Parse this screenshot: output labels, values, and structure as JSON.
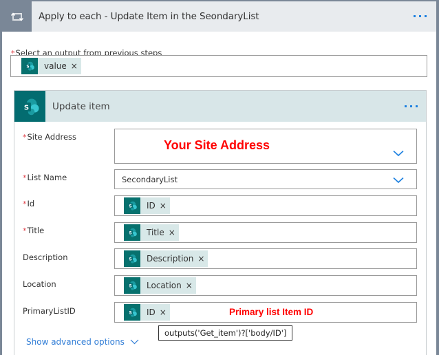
{
  "loop": {
    "title": "Apply to each - Update Item in the SeondaryList",
    "icon": "loop-icon",
    "menu_icon": "more-options-icon"
  },
  "select_output": {
    "required_mark": "*",
    "label": "Select an output from previous steps",
    "token": {
      "icon": "sharepoint-icon",
      "text": "value",
      "remove": "×"
    }
  },
  "action": {
    "title": "Update item",
    "icon": "sharepoint-icon",
    "menu_icon": "more-options-icon",
    "fields": {
      "site_address": {
        "required_mark": "*",
        "label": "Site Address",
        "value": "",
        "annotation": "Your Site Address"
      },
      "list_name": {
        "required_mark": "*",
        "label": "List Name",
        "value": "SecondaryList"
      },
      "id": {
        "required_mark": "*",
        "label": "Id",
        "token": {
          "text": "ID",
          "remove": "×"
        }
      },
      "title": {
        "required_mark": "*",
        "label": "Title",
        "token": {
          "text": "Title",
          "remove": "×"
        }
      },
      "description": {
        "label": "Description",
        "token": {
          "text": "Description",
          "remove": "×"
        }
      },
      "location": {
        "label": "Location",
        "token": {
          "text": "Location",
          "remove": "×"
        }
      },
      "primary_list_id": {
        "label": "PrimaryListID",
        "token": {
          "text": "ID",
          "remove": "×"
        },
        "annotation": "Primary list Item ID",
        "tooltip": "outputs('Get_item')?['body/ID']"
      }
    },
    "advanced_label": "Show advanced options"
  },
  "colors": {
    "accent": "#1a7fe0",
    "sharepoint": "#036c70",
    "annotation": "#ff0000",
    "required": "#e0424a",
    "loop_frame": "#7a8797"
  }
}
